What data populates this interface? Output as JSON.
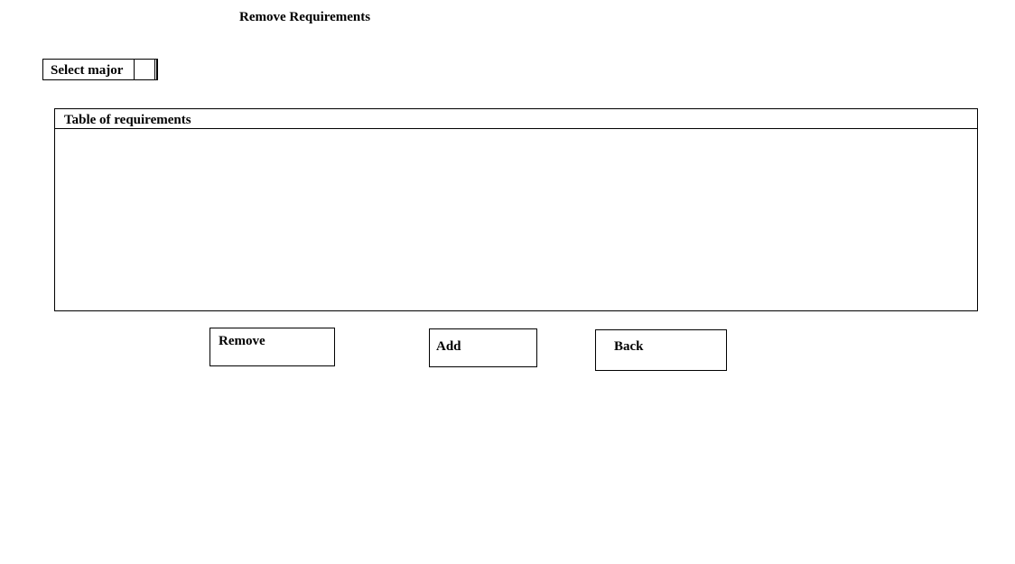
{
  "page": {
    "title": "Remove Requirements"
  },
  "major_selector": {
    "label": "Select major",
    "selected_value": ""
  },
  "requirements_table": {
    "header": "Table of requirements",
    "rows": []
  },
  "actions": {
    "remove_label": "Remove",
    "add_label": "Add",
    "back_label": "Back"
  }
}
